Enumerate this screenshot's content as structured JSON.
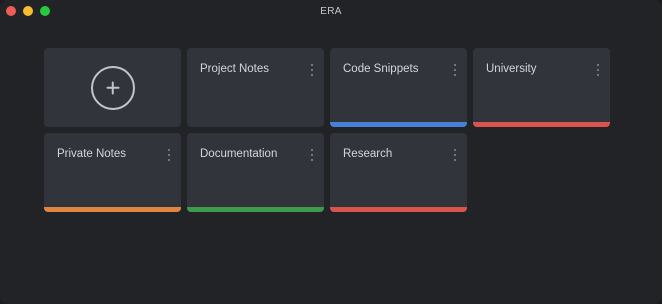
{
  "window": {
    "title": "ERA"
  },
  "add_card": {
    "icon": "plus-circle-icon"
  },
  "notebooks": [
    {
      "label": "Project Notes",
      "accent": ""
    },
    {
      "label": "Code Snippets",
      "accent": "#4a7fd6"
    },
    {
      "label": "University",
      "accent": "#d9534f"
    },
    {
      "label": "Private Notes",
      "accent": "#e0843f"
    },
    {
      "label": "Documentation",
      "accent": "#3e9a4b"
    },
    {
      "label": "Research",
      "accent": "#d9534f"
    }
  ]
}
